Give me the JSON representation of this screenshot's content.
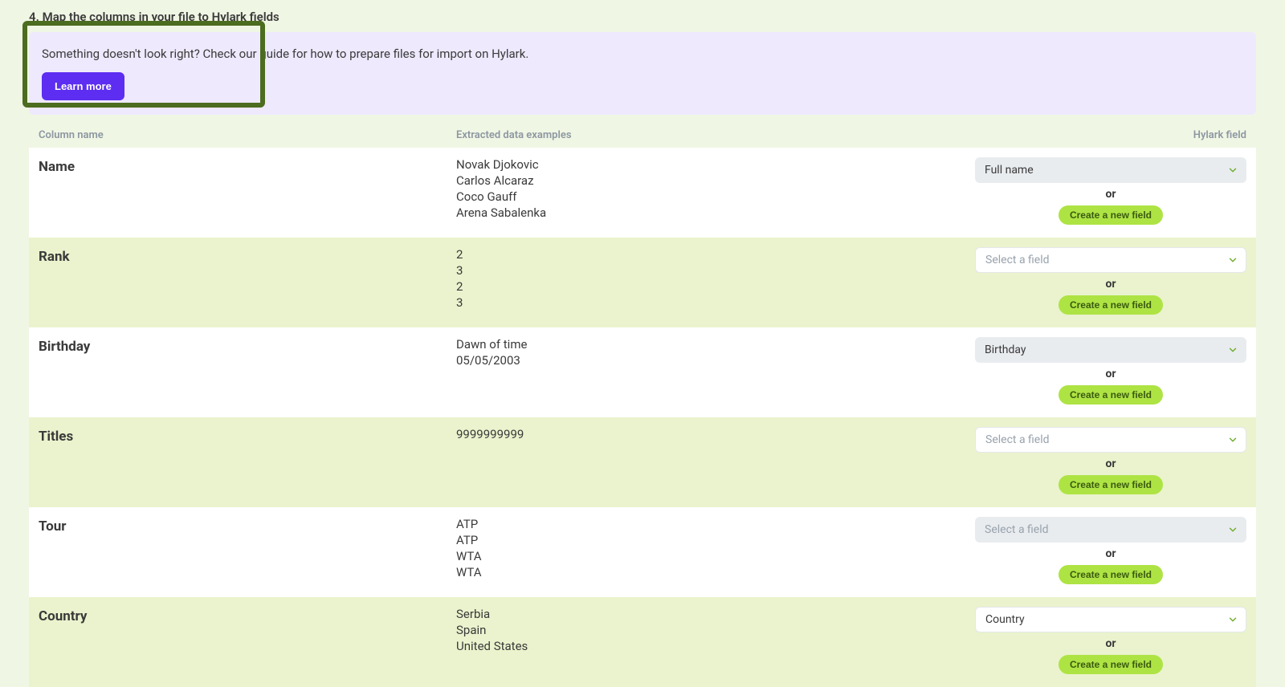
{
  "step": {
    "number": "4.",
    "title": "Map the columns in your file to Hylark fields"
  },
  "banner": {
    "text": "Something doesn't look right? Check our guide for how to prepare files for import on Hylark.",
    "button": "Learn more"
  },
  "headers": {
    "col": "Column name",
    "examples": "Extracted data examples",
    "field": "Hylark field"
  },
  "labels": {
    "or": "or",
    "create": "Create a new field",
    "placeholder": "Select a field"
  },
  "rows": [
    {
      "name": "Name",
      "examples": [
        "Novak Djokovic",
        "Carlos Alcaraz",
        "Coco Gauff",
        "Arena Sabalenka"
      ],
      "selected": "Full name",
      "alt": false
    },
    {
      "name": "Rank",
      "examples": [
        "2",
        "3",
        "2",
        "3"
      ],
      "selected": null,
      "alt": true
    },
    {
      "name": "Birthday",
      "examples": [
        "Dawn of time",
        "05/05/2003"
      ],
      "selected": "Birthday",
      "alt": false
    },
    {
      "name": "Titles",
      "examples": [
        "9999999999"
      ],
      "selected": null,
      "alt": true
    },
    {
      "name": "Tour",
      "examples": [
        "ATP",
        "ATP",
        "WTA",
        "WTA"
      ],
      "selected": null,
      "alt": false
    },
    {
      "name": "Country",
      "examples": [
        "Serbia",
        "Spain",
        "United States"
      ],
      "selected": "Country",
      "alt": true
    }
  ]
}
